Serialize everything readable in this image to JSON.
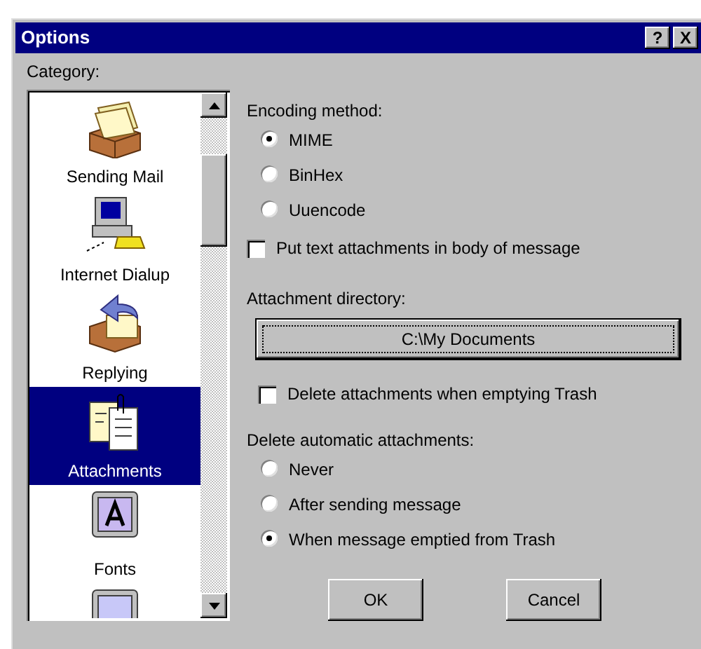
{
  "window": {
    "title": "Options",
    "title_buttons": [
      "?",
      "X"
    ]
  },
  "category": {
    "label": "Category:",
    "items": [
      {
        "kind": "sending",
        "label": "Sending Mail",
        "selected": false
      },
      {
        "kind": "dialup",
        "label": "Internet Dialup",
        "selected": false
      },
      {
        "kind": "replying",
        "label": "Replying",
        "selected": false
      },
      {
        "kind": "attachments",
        "label": "Attachments",
        "selected": true
      },
      {
        "kind": "fonts",
        "label": "Fonts",
        "selected": false
      },
      {
        "kind": "display",
        "selected": false
      }
    ]
  },
  "encoding": {
    "label": "Encoding method:",
    "options": [
      {
        "label": "MIME",
        "selected": true
      },
      {
        "label": "BinHex",
        "selected": false
      },
      {
        "label": "Uuencode",
        "selected": false
      }
    ]
  },
  "put_text_in_body": {
    "label": "Put text attachments in body of message",
    "checked": false
  },
  "attachment_directory": {
    "label": "Attachment directory:",
    "button": "C:\\My Documents"
  },
  "delete_when_emptying_trash": {
    "label": "Delete attachments when emptying Trash",
    "checked": false
  },
  "delete_automatic": {
    "label": "Delete automatic attachments:",
    "options": [
      {
        "label": "Never",
        "selected": false
      },
      {
        "label": "After sending message",
        "selected": false
      },
      {
        "label": "When message emptied from Trash",
        "selected": true
      }
    ]
  },
  "buttons": [
    "OK",
    "Cancel"
  ]
}
